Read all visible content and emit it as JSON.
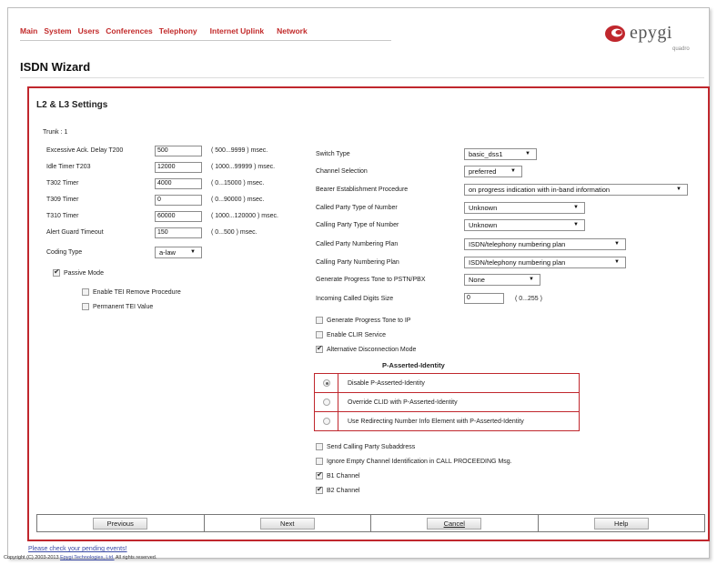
{
  "nav": {
    "items": [
      "Main",
      "System",
      "Users",
      "Conferences",
      "Telephony",
      "Internet Uplink",
      "Network"
    ]
  },
  "logo": {
    "name": "epygi",
    "subtitle": "quadro"
  },
  "page_title": "ISDN Wizard",
  "section_title": "L2 & L3 Settings",
  "trunk_label": "Trunk :  1",
  "timers": [
    {
      "label": "Excessive Ack. Delay T200",
      "value": "500",
      "range": "( 500...9999 ) msec."
    },
    {
      "label": "Idle Timer T203",
      "value": "12000",
      "range": "( 1000...99999 ) msec."
    },
    {
      "label": "T302 Timer",
      "value": "4000",
      "range": "( 0...15000 ) msec."
    },
    {
      "label": "T309 Timer",
      "value": "0",
      "range": "( 0...90000 ) msec."
    },
    {
      "label": "T310 Timer",
      "value": "60000",
      "range": "( 1000...120000 ) msec."
    },
    {
      "label": "Alert Guard Timeout",
      "value": "150",
      "range": "( 0...500 ) msec."
    }
  ],
  "coding_type": {
    "label": "Coding Type",
    "value": "a-law"
  },
  "passive_mode": {
    "label": "Passive Mode",
    "checked": true
  },
  "enable_tei_remove": {
    "label": "Enable TEI Remove Procedure",
    "checked": false
  },
  "permanent_tei": {
    "label": "Permanent TEI Value",
    "checked": false
  },
  "right_selects": [
    {
      "label": "Switch Type",
      "value": "basic_dss1"
    },
    {
      "label": "Channel Selection",
      "value": "preferred"
    },
    {
      "label": "Bearer Establishment Procedure",
      "value": "on progress indication with in-band information"
    },
    {
      "label": "Called Party Type of Number",
      "value": "Unknown"
    },
    {
      "label": "Calling Party Type of Number",
      "value": "Unknown"
    },
    {
      "label": "Called Party Numbering Plan",
      "value": "ISDN/telephony numbering plan"
    },
    {
      "label": "Calling Party Numbering Plan",
      "value": "ISDN/telephony numbering plan"
    },
    {
      "label": "Generate Progress Tone to PSTN/PBX",
      "value": "None"
    }
  ],
  "incoming_digits": {
    "label": "Incoming Called Digits Size",
    "value": "0",
    "range": "( 0...255 )"
  },
  "checks_mid": [
    {
      "label": "Generate Progress Tone to IP",
      "checked": false
    },
    {
      "label": "Enable CLIR Service",
      "checked": false
    },
    {
      "label": "Alternative Disconnection Mode",
      "checked": true
    }
  ],
  "p_asserted": {
    "title": "P-Asserted-Identity",
    "options": [
      {
        "label": "Disable P-Asserted-Identity",
        "selected": true
      },
      {
        "label": "Override CLID with P-Asserted-Identity",
        "selected": false
      },
      {
        "label": "Use Redirecting Number Info Element with P-Asserted-Identity",
        "selected": false
      }
    ]
  },
  "checks_bottom": [
    {
      "label": "Send Calling Party Subaddress",
      "checked": false
    },
    {
      "label": "Ignore Empty Channel Identification in CALL PROCEEDING Msg.",
      "checked": false
    },
    {
      "label": "B1 Channel",
      "checked": true
    },
    {
      "label": "B2 Channel",
      "checked": true
    }
  ],
  "buttons": {
    "previous": "Previous",
    "next": "Next",
    "cancel": "Cancel",
    "help": "Help"
  },
  "footer": {
    "pending": "Please check your pending events!",
    "copyright_pre": "Copyright (C) 2003-2013 ",
    "copyright_link": "Epygi Technologies, Ltd.",
    "copyright_post": " All rights reserved."
  },
  "colors": {
    "accent": "#c0272d",
    "nav_text": "#c22a2a",
    "link": "#3a4aa6"
  }
}
